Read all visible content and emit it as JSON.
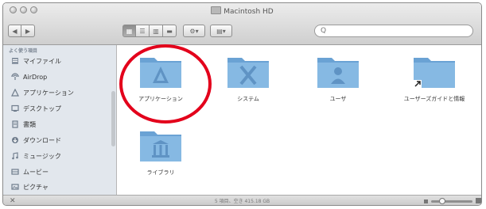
{
  "window": {
    "title": "Macintosh HD"
  },
  "toolbar": {
    "back_label": "◀",
    "forward_label": "▶",
    "views": [
      "▦",
      "☰",
      "▥",
      "▬"
    ],
    "action_label": "⚙▾",
    "arrange_label": "▤▾",
    "search_placeholder": "Q"
  },
  "sidebar": {
    "heading": "よく使う項目",
    "items": [
      {
        "label": "マイファイル",
        "icon": "files-icon"
      },
      {
        "label": "AirDrop",
        "icon": "airdrop-icon"
      },
      {
        "label": "アプリケーション",
        "icon": "applications-icon"
      },
      {
        "label": "デスクトップ",
        "icon": "desktop-icon"
      },
      {
        "label": "書類",
        "icon": "documents-icon"
      },
      {
        "label": "ダウンロード",
        "icon": "downloads-icon"
      },
      {
        "label": "ミュージック",
        "icon": "music-icon"
      },
      {
        "label": "ムービー",
        "icon": "movies-icon"
      },
      {
        "label": "ピクチャ",
        "icon": "pictures-icon"
      }
    ]
  },
  "folders": [
    {
      "label": "アプリケーション",
      "icon": "applications-folder-icon"
    },
    {
      "label": "システム",
      "icon": "system-folder-icon"
    },
    {
      "label": "ユーザ",
      "icon": "users-folder-icon"
    },
    {
      "label": "ユーザーズガイドと情報",
      "icon": "alias-folder-icon"
    },
    {
      "label": "ライブラリ",
      "icon": "library-folder-icon"
    }
  ],
  "statusbar": {
    "text": "5 項目、空き 415.18 GB"
  },
  "colors": {
    "highlight_ring": "#e3001b",
    "folder": "#7fb2de",
    "sidebar": "#e2e7ed"
  }
}
